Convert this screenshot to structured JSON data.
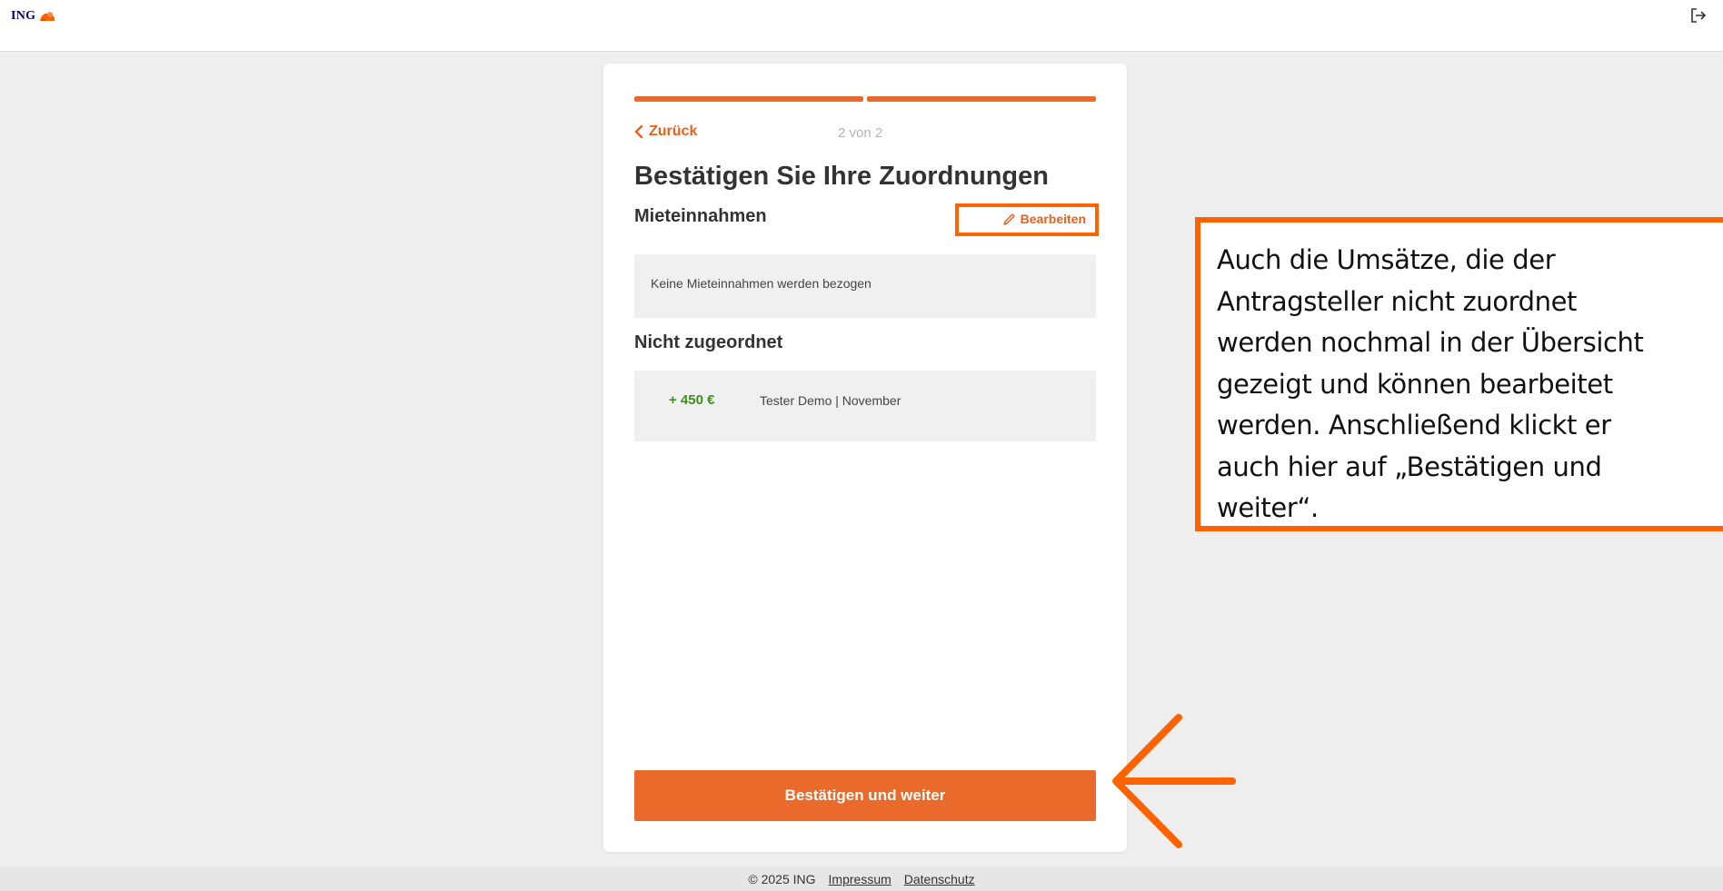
{
  "header": {
    "logo_text": "ING",
    "logo_icon": "lion-icon",
    "logout_icon": "logout-icon"
  },
  "card": {
    "back_label": "Zurück",
    "step_indicator": "2 von 2",
    "title": "Bestätigen Sie Ihre Zuordnungen",
    "rental_section": {
      "heading": "Mieteinnahmen",
      "edit_label": "Bearbeiten",
      "empty_text": "Keine Mieteinnahmen werden bezogen"
    },
    "unassigned_section": {
      "heading": "Nicht zugeordnet",
      "transactions": [
        {
          "amount": "+ 450 €",
          "label": "Tester Demo | November"
        }
      ]
    },
    "confirm_label": "Bestätigen und weiter"
  },
  "callout": {
    "text": "Auch die Umsätze, die der\nAntragsteller nicht zuordnet\nwerden nochmal in der Übersicht\ngezeigt und können bearbeitet\nwerden. Anschließend klickt er\nauch hier auf „Bestätigen und\nweiter“."
  },
  "footer": {
    "copyright": "© 2025 ING",
    "impressum": "Impressum",
    "datenschutz": "Datenschutz"
  },
  "colors": {
    "accent": "#ea6a2b",
    "highlight": "#ff6200",
    "positive_amount": "#3e8e1f"
  }
}
